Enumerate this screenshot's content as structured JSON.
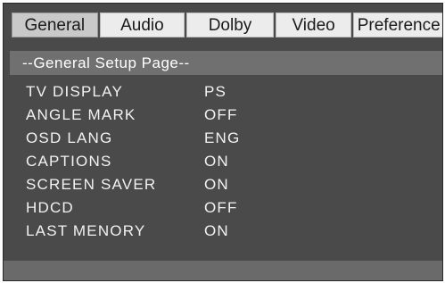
{
  "tabs": [
    {
      "label": "General",
      "active": true
    },
    {
      "label": "Audio"
    },
    {
      "label": "Dolby"
    },
    {
      "label": "Video"
    },
    {
      "label": "Preference"
    }
  ],
  "page_title": "--General Setup Page--",
  "settings": [
    {
      "label": "TV DISPLAY",
      "value": "PS"
    },
    {
      "label": "ANGLE MARK",
      "value": "OFF"
    },
    {
      "label": "OSD LANG",
      "value": "ENG"
    },
    {
      "label": "CAPTIONS",
      "value": "ON"
    },
    {
      "label": "SCREEN SAVER",
      "value": "ON"
    },
    {
      "label": "HDCD",
      "value": "OFF"
    },
    {
      "label": "LAST MENORY",
      "value": "ON"
    }
  ]
}
